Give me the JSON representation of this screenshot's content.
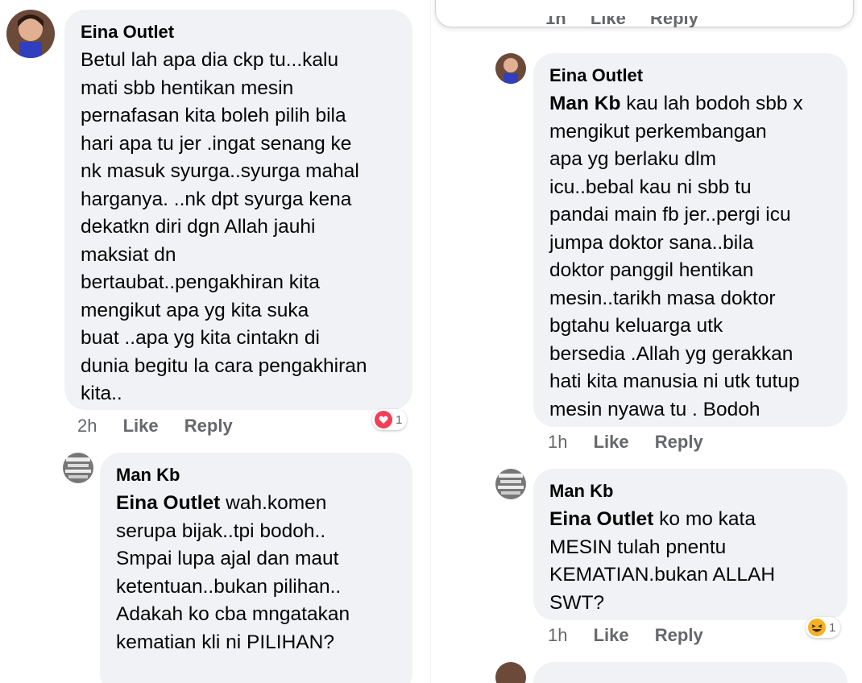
{
  "left": {
    "comment1": {
      "author": "Eina Outlet",
      "text": "Betul lah apa dia ckp tu...kalu\nmati sbb hentikan mesin\npernafasan kita boleh pilih bila\nhari apa tu jer .ingat senang ke\nnk masuk syurga..syurga mahal\nharganya. ..nk dpt syurga kena\ndekatkn diri dgn Allah jauhi\nmaksiat dn\nbertaubat..pengakhiran kita\nmengikut apa yg kita suka\nbuat ..apa yg kita cintakn di\ndunia begitu la cara pengakhiran\nkita..",
      "time": "2h",
      "like": "Like",
      "reply": "Reply",
      "reaction_count": "1",
      "reaction_icon": "heart-icon",
      "reaction_color": "#f33e58"
    },
    "comment2": {
      "author": "Man Kb",
      "mention": "Eina Outlet",
      "text": " wah.komen\nserupa bijak..tpi bodoh..\nSmpai lupa ajal dan maut\nketentuan..bukan pilihan..\nAdakah ko cba mngatakan\nkematian kli ni PILIHAN?"
    }
  },
  "right": {
    "top_partial": {
      "time": "1h",
      "like": "Like",
      "reply": "Reply"
    },
    "comment1": {
      "author": "Eina Outlet",
      "mention": "Man Kb",
      "text": " kau lah bodoh sbb x\nmengikut perkembangan\napa yg berlaku dlm\nicu..bebal kau ni sbb tu\npandai main fb jer..pergi icu\njumpa doktor sana..bila\ndoktor panggil hentikan\nmesin..tarikh masa doktor\nbgtahu keluarga utk\nbersedia .Allah yg gerakkan\nhati kita manusia ni utk tutup\nmesin nyawa tu . Bodoh",
      "time": "1h",
      "like": "Like",
      "reply": "Reply"
    },
    "comment2": {
      "author": "Man Kb",
      "mention": "Eina Outlet",
      "text": " ko mo kata\nMESIN tulah pnentu\nKEMATIAN.bukan ALLAH\nSWT?",
      "time": "1h",
      "like": "Like",
      "reply": "Reply",
      "reaction_count": "1",
      "reaction_icon": "laughing-emoji-icon",
      "reaction_color": "#f7b125"
    }
  }
}
